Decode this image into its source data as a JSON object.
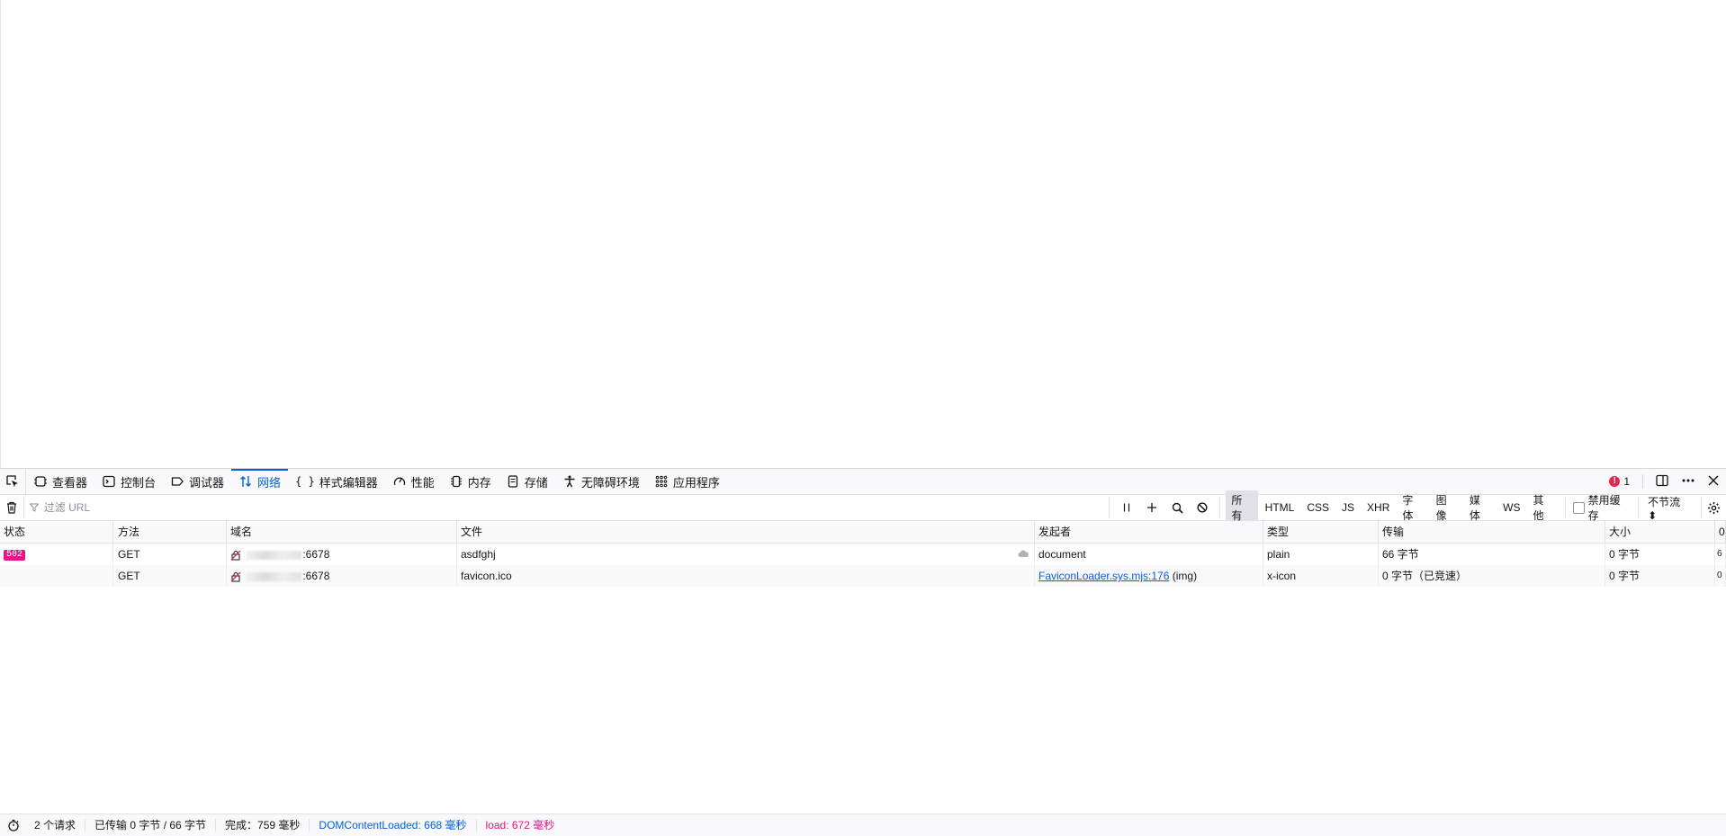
{
  "tabs": [
    {
      "id": "inspector",
      "label": "查看器",
      "icon": "inspector-icon"
    },
    {
      "id": "console",
      "label": "控制台",
      "icon": "console-icon"
    },
    {
      "id": "debugger",
      "label": "调试器",
      "icon": "debugger-icon"
    },
    {
      "id": "network",
      "label": "网络",
      "icon": "network-icon",
      "active": true
    },
    {
      "id": "style-editor",
      "label": "样式编辑器",
      "icon": "style-editor-icon"
    },
    {
      "id": "performance",
      "label": "性能",
      "icon": "performance-icon"
    },
    {
      "id": "memory",
      "label": "内存",
      "icon": "memory-icon"
    },
    {
      "id": "storage",
      "label": "存储",
      "icon": "storage-icon"
    },
    {
      "id": "accessibility",
      "label": "无障碍环境",
      "icon": "accessibility-icon"
    },
    {
      "id": "application",
      "label": "应用程序",
      "icon": "application-icon"
    }
  ],
  "error_count": "1",
  "toolbar": {
    "filter_placeholder": "过滤 URL",
    "filter_value": "",
    "type_filters": [
      "所有",
      "HTML",
      "CSS",
      "JS",
      "XHR",
      "字体",
      "图像",
      "媒体",
      "WS",
      "其他"
    ],
    "active_type_filter": "所有",
    "disable_cache_label": "禁用缓存",
    "throttle_label": "不节流 ⬍"
  },
  "table": {
    "headers": {
      "status": "状态",
      "method": "方法",
      "domain": "域名",
      "file": "文件",
      "initiator": "发起者",
      "type": "类型",
      "transferred": "传输",
      "size": "大小",
      "waterfall": "0"
    },
    "rows": [
      {
        "status": "502",
        "method": "GET",
        "domain_suffix": ":6678",
        "file": "asdfghj",
        "initiator": "document",
        "initiator_link": "",
        "initiator_suffix": "",
        "type": "plain",
        "transferred": "66 字节",
        "size": "0 字节",
        "waterfall": "6"
      },
      {
        "status": "",
        "method": "GET",
        "domain_suffix": ":6678",
        "file": "favicon.ico",
        "initiator": "",
        "initiator_link": "FaviconLoader.sys.mjs:176",
        "initiator_suffix": " (img)",
        "type": "x-icon",
        "transferred": "0 字节（已竞速）",
        "size": "0 字节",
        "waterfall": "0"
      }
    ]
  },
  "statusbar": {
    "requests": "2 个请求",
    "transferred": "已传输 0 字节 / 66 字节",
    "finish": "完成：759 毫秒",
    "dom_content_loaded": "DOMContentLoaded: 668 毫秒",
    "load": "load: 672 毫秒"
  },
  "colors": {
    "accent": "#0061e0",
    "status_502": "#e31587",
    "error": "#e22850"
  }
}
